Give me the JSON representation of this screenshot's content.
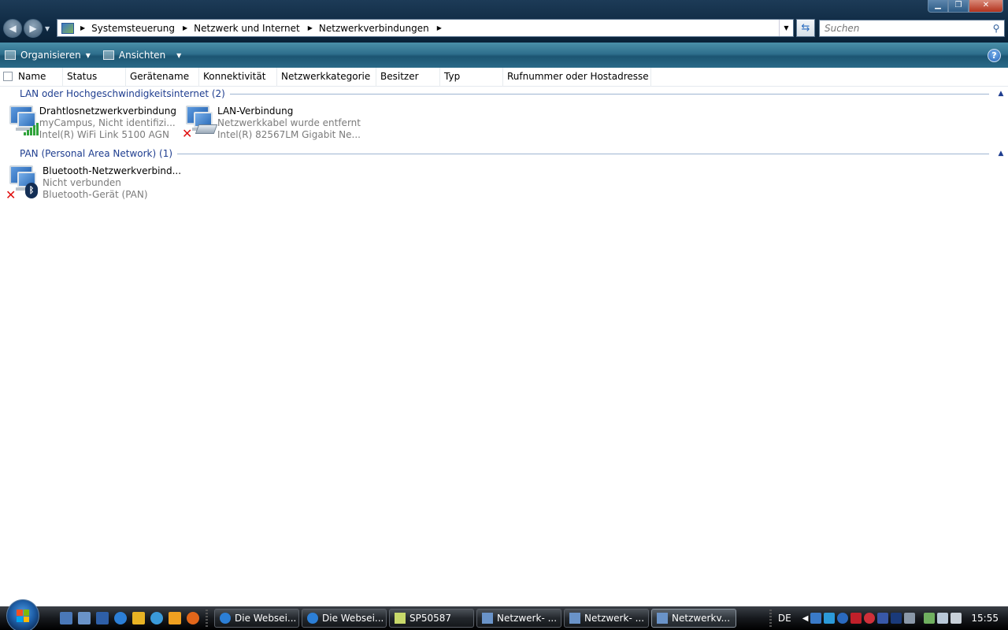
{
  "address": {
    "crumbs": [
      "Systemsteuerung",
      "Netzwerk und Internet",
      "Netzwerkverbindungen"
    ]
  },
  "search": {
    "placeholder": "Suchen"
  },
  "toolbar": {
    "organize_label": "Organisieren",
    "views_label": "Ansichten",
    "help_label": "?"
  },
  "columns": [
    "Name",
    "Status",
    "Gerätename",
    "Konnektivität",
    "Netzwerkkategorie",
    "Besitzer",
    "Typ",
    "Rufnummer oder Hostadresse"
  ],
  "groups": [
    {
      "title": "LAN oder Hochgeschwindigkeitsinternet (2)",
      "items": [
        {
          "name": "Drahtlosnetzwerkverbindung",
          "status": "myCampus, Nicht identifizi...",
          "device": "Intel(R) WiFi Link 5100 AGN",
          "icon": "wireless-network-icon"
        },
        {
          "name": "LAN-Verbindung",
          "status": "Netzwerkkabel wurde entfernt",
          "device": "Intel(R) 82567LM Gigabit Ne...",
          "icon": "lan-disconnected-icon"
        }
      ]
    },
    {
      "title": "PAN (Personal Area Network) (1)",
      "items": [
        {
          "name": "Bluetooth-Netzwerkverbind...",
          "status": "Nicht verbunden",
          "device": "Bluetooth-Gerät (PAN)",
          "icon": "bluetooth-network-icon"
        }
      ]
    }
  ],
  "taskbar": {
    "tasks": [
      "Die Websei...",
      "Die Websei...",
      "SP50587",
      "Netzwerk- ...",
      "Netzwerk- ...",
      "Netzwerkv..."
    ],
    "language": "DE",
    "clock": "15:55"
  },
  "colors": {
    "accent": "#1e3d8f",
    "toolbar": "#2e6f8d",
    "error": "#e01010"
  }
}
